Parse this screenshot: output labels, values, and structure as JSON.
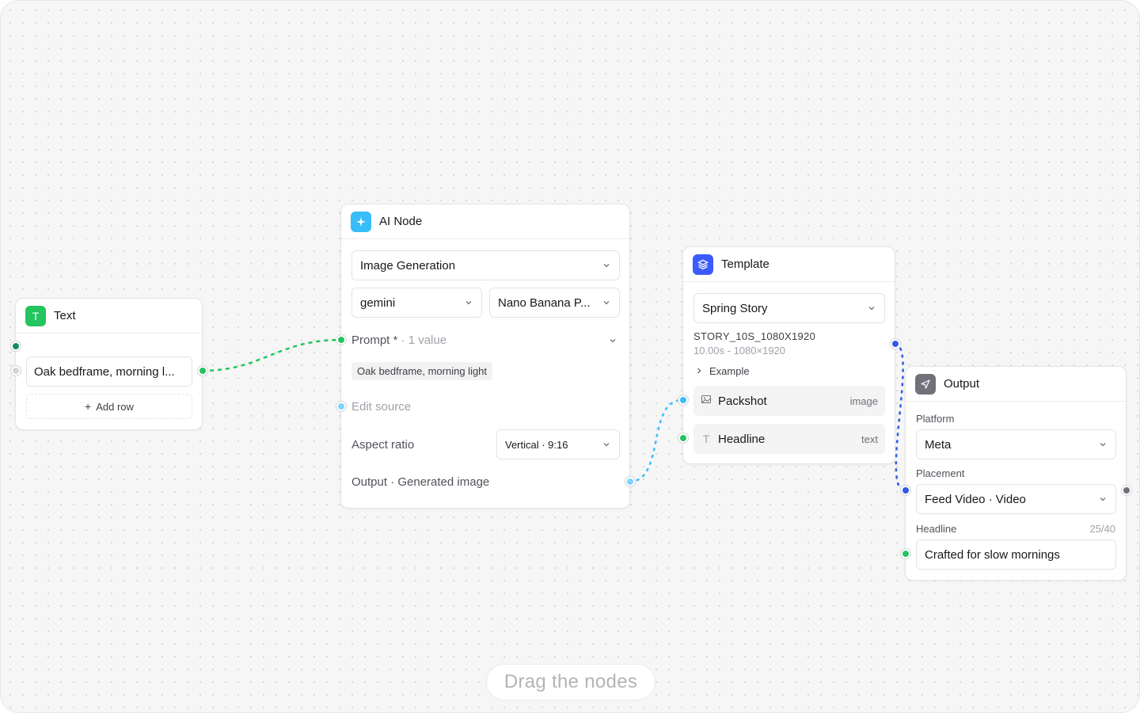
{
  "text_node": {
    "icon": "T",
    "title": "Text",
    "row_value": "Oak bedframe, morning l...",
    "add_row_label": "Add row",
    "color": "#22c55e"
  },
  "ai_node": {
    "title": "AI Node",
    "task": "Image Generation",
    "provider": "gemini",
    "model": "Nano Banana P...",
    "prompt_label": "Prompt *",
    "prompt_count": "· 1 value",
    "prompt_chip": "Oak bedframe, morning light",
    "edit_source_label": "Edit source",
    "aspect_label": "Aspect ratio",
    "aspect_value": "Vertical · 9:16",
    "output_label": "Output · Generated image",
    "color": "#38bdf8"
  },
  "template_node": {
    "title": "Template",
    "template": "Spring Story",
    "code": "STORY_10S_1080X1920",
    "meta": "10.00s - 1080×1920",
    "example_label": "Example",
    "slots": [
      {
        "name": "Packshot",
        "type": "image",
        "icon": "image-icon"
      },
      {
        "name": "Headline",
        "type": "text",
        "icon": "text-icon"
      }
    ],
    "color": "#3b5bfd"
  },
  "output_node": {
    "title": "Output",
    "platform_label": "Platform",
    "platform_value": "Meta",
    "placement_label": "Placement",
    "placement_value": "Feed Video · Video",
    "headline_label": "Headline",
    "headline_count": "25/40",
    "headline_value": "Crafted for slow mornings",
    "color": "#71717a"
  },
  "hint": "Drag the nodes",
  "colors": {
    "green_wire": "#22c55e",
    "blue_wire": "#38bdf8",
    "indigo_wire": "#2f5bea"
  }
}
